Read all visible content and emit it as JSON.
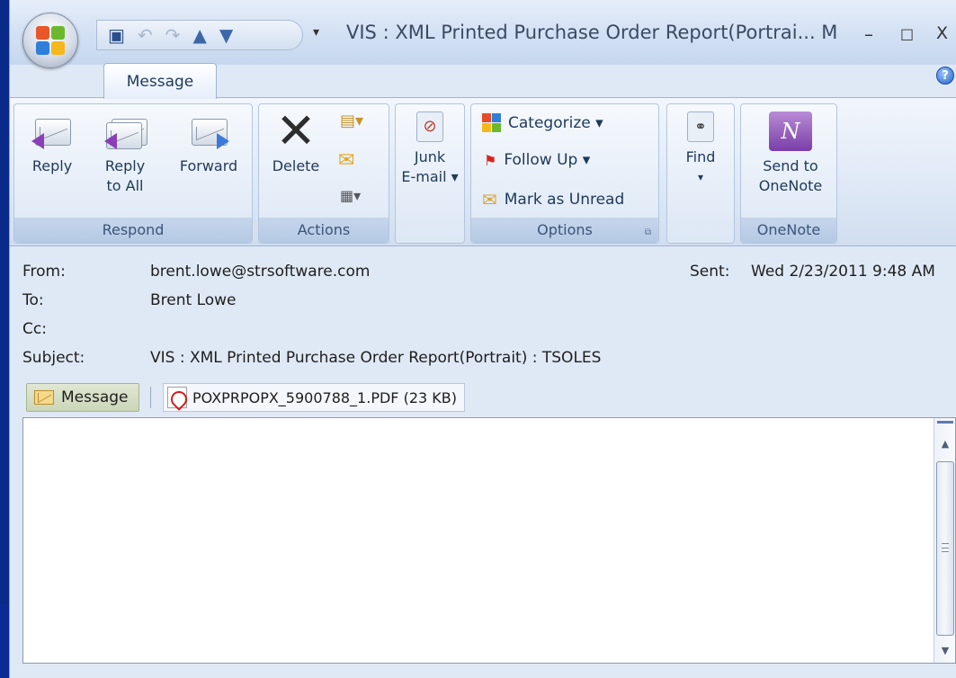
{
  "window": {
    "title": "VIS : XML Printed Purchase Order Report(Portrai... M",
    "minimize": "–",
    "maximize": "□",
    "close": "X"
  },
  "tabs": [
    {
      "label": "Message"
    }
  ],
  "ribbon": {
    "respond": {
      "label": "Respond",
      "reply": "Reply",
      "reply_all_line1": "Reply",
      "reply_all_line2": "to All",
      "forward": "Forward"
    },
    "actions": {
      "label": "Actions",
      "delete": "Delete"
    },
    "junk": {
      "line1": "Junk",
      "line2": "E-mail ▾"
    },
    "options": {
      "label": "Options",
      "categorize": "Categorize ▾",
      "follow_up": "Follow Up ▾",
      "mark_unread": "Mark as Unread"
    },
    "find": {
      "label": "Find",
      "arrow": "▾"
    },
    "onenote": {
      "label": "OneNote",
      "line1": "Send to",
      "line2": "OneNote"
    }
  },
  "header": {
    "from_label": "From:",
    "from_value": "brent.lowe@strsoftware.com",
    "to_label": "To:",
    "to_value": "Brent Lowe",
    "cc_label": "Cc:",
    "cc_value": "",
    "subject_label": "Subject:",
    "subject_value": "VIS : XML Printed Purchase Order Report(Portrait) : TSOLES",
    "sent_label": "Sent:",
    "sent_value": "Wed 2/23/2011 9:48 AM"
  },
  "attachments": {
    "message_tab": "Message",
    "file": "POXPRPOPX_5900788_1.PDF (23 KB)"
  },
  "colors": {
    "accent": "#dfe9f5",
    "desktop": "#0b2a94"
  }
}
